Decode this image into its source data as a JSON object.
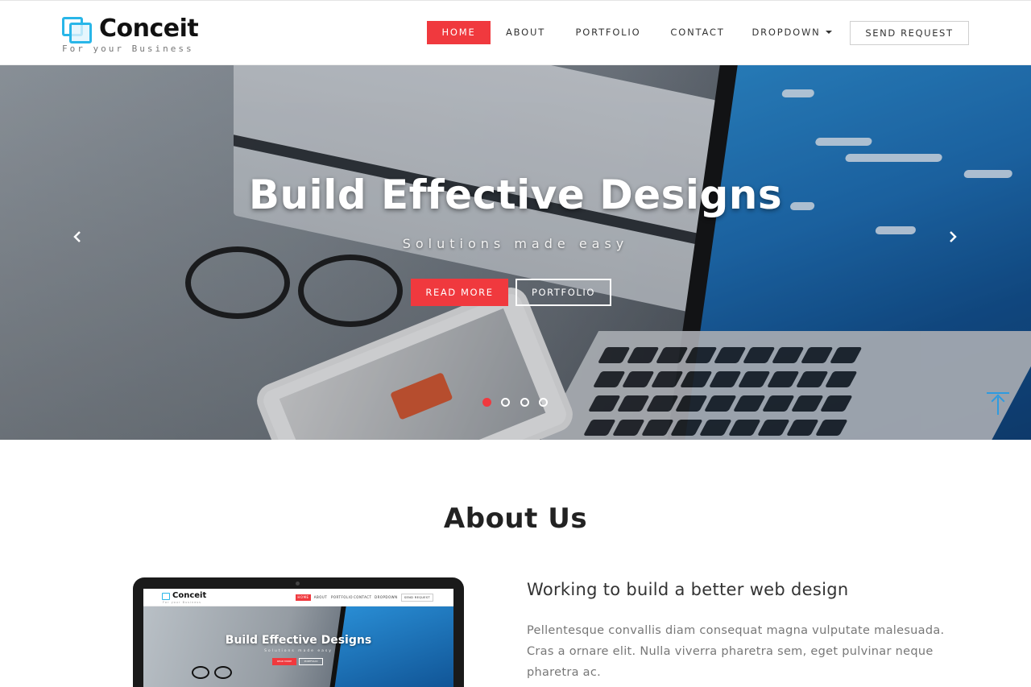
{
  "brand": {
    "name": "Conceit",
    "tagline": "For your Business"
  },
  "nav": {
    "items": [
      {
        "label": "HOME",
        "active": true
      },
      {
        "label": "ABOUT",
        "active": false
      },
      {
        "label": "PORTFOLIO",
        "active": false
      },
      {
        "label": "CONTACT",
        "active": false
      },
      {
        "label": "DROPDOWN",
        "active": false,
        "has_caret": true
      }
    ],
    "cta": "SEND REQUEST"
  },
  "hero": {
    "title": "Build Effective Designs",
    "subtitle": "Solutions made easy",
    "primary_button": "READ MORE",
    "secondary_button": "PORTFOLIO",
    "prev_icon": "chevron-left-icon",
    "next_icon": "chevron-right-icon",
    "slides": 4,
    "active_slide": 1
  },
  "about": {
    "title": "About Us",
    "heading": "Working to build a better web design",
    "paragraph": "Pellentesque convallis diam consequat magna vulputate malesuada. Cras a ornare elit. Nulla viverra pharetra sem, eget pulvinar neque pharetra ac.",
    "mockup": {
      "brand": "Conceit",
      "tagline": "For your Business",
      "nav": [
        "HOME",
        "ABOUT",
        "PORTFOLIO",
        "CONTACT",
        "DROPDOWN",
        "SEND REQUEST"
      ],
      "hero_title": "Build Effective Designs",
      "hero_subtitle": "Solutions made easy",
      "btn1": "READ MORE",
      "btn2": "PORTFOLIO"
    }
  },
  "colors": {
    "accent": "#f0393e",
    "logo_blue": "#29b6e8",
    "scroll_top_blue": "#2e9be0"
  }
}
